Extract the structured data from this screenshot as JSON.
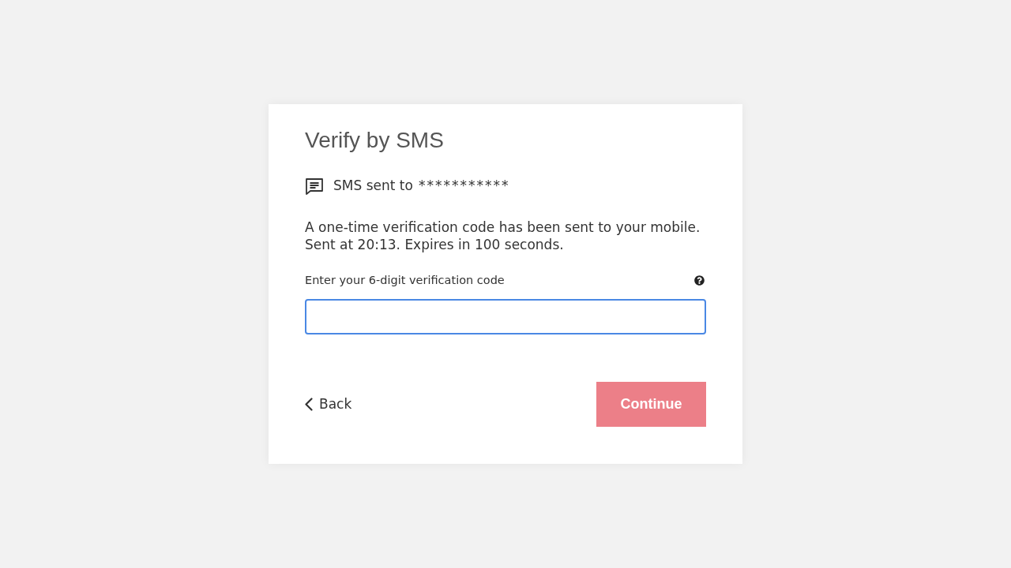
{
  "card": {
    "title": "Verify by SMS",
    "sms_notice": {
      "label": "SMS sent to",
      "masked_number": "***********"
    },
    "message_lines": [
      "A one-time verification code has been sent to your mobile.",
      "Sent at 20:13. Expires in 100 seconds."
    ],
    "code_field": {
      "label": "Enter your 6-digit verification code",
      "focused": true
    },
    "back_link": {
      "label": "Back"
    },
    "continue_button": {
      "label": "Continue",
      "disabled": true
    }
  }
}
